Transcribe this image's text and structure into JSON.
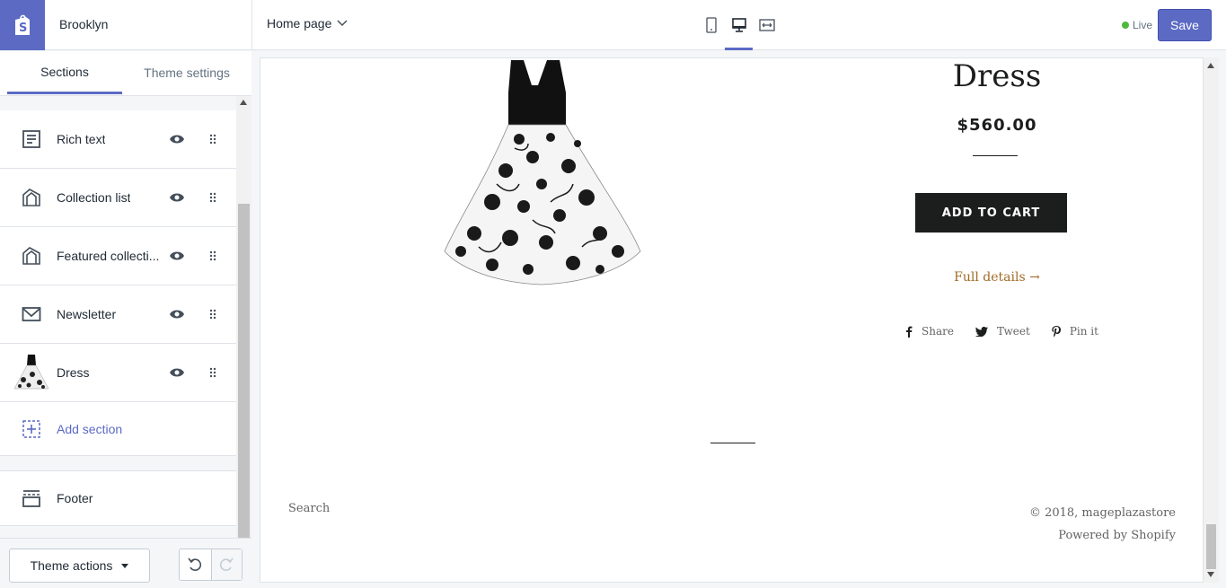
{
  "app": {
    "store_name": "Brooklyn",
    "page_selector": "Home page",
    "status": "Live",
    "save_label": "Save",
    "accent_color": "#5c6ac4",
    "device_icons": [
      "mobile-icon",
      "desktop-icon",
      "fullwidth-icon"
    ],
    "active_device": "desktop"
  },
  "sidebar": {
    "tabs": [
      {
        "label": "Sections",
        "active": true
      },
      {
        "label": "Theme settings",
        "active": false
      }
    ],
    "items": [
      {
        "label": "Rich text",
        "icon": "text-icon"
      },
      {
        "label": "Collection list",
        "icon": "collection-icon"
      },
      {
        "label": "Featured collecti...",
        "icon": "collection-icon"
      },
      {
        "label": "Newsletter",
        "icon": "envelope-icon"
      },
      {
        "label": "Dress",
        "icon": "dress-thumbnail"
      }
    ],
    "add_section": "Add section",
    "footer": "Footer",
    "theme_actions": "Theme actions"
  },
  "preview": {
    "product_name": "Dress",
    "price": "$560.00",
    "add_to_cart": "ADD TO CART",
    "full_details": "Full details",
    "social": {
      "share": "Share",
      "tweet": "Tweet",
      "pin": "Pin it"
    },
    "footer_search": "Search",
    "copyright": "© 2018, mageplazastore",
    "powered_by": "Powered by Shopify"
  }
}
